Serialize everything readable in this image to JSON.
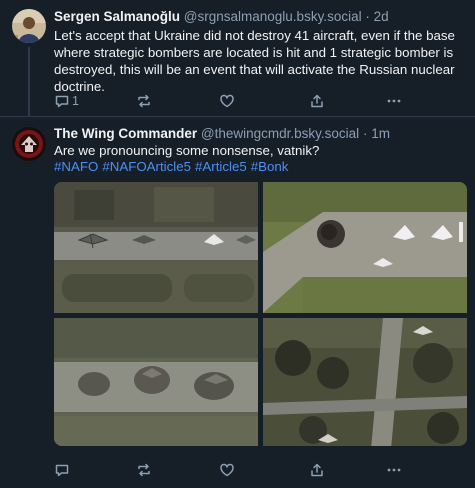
{
  "posts": [
    {
      "author_name": "Sergen Salmanoğlu",
      "handle": "@srgnsalmanoglu.bsky.social",
      "separator": "·",
      "time": "2d",
      "text": "Let's accept that Ukraine did not destroy 41 aircraft, even if the base where strategic bombers are located is hit and 1 strategic bomber is destroyed, this will be an event that will activate the Russian nuclear doctrine.",
      "reply_count": "1"
    },
    {
      "author_name": "The Wing Commander",
      "handle": "@thewingcmdr.bsky.social",
      "separator": "·",
      "time": "1m",
      "text": "Are we pronouncing some nonsense, vatnik?",
      "hashtags": [
        "#NAFO",
        "#NAFOArticle5",
        "#Article5",
        "#Bonk"
      ],
      "reply_count": ""
    }
  ],
  "icons": [
    "reply-icon",
    "repost-icon",
    "like-icon",
    "share-icon",
    "more-icon"
  ],
  "colors": {
    "background": "#161e27",
    "text": "#f1f3f5",
    "muted": "#8d9fb4",
    "link": "#4c8ff5",
    "divider": "#2c3a4b"
  }
}
